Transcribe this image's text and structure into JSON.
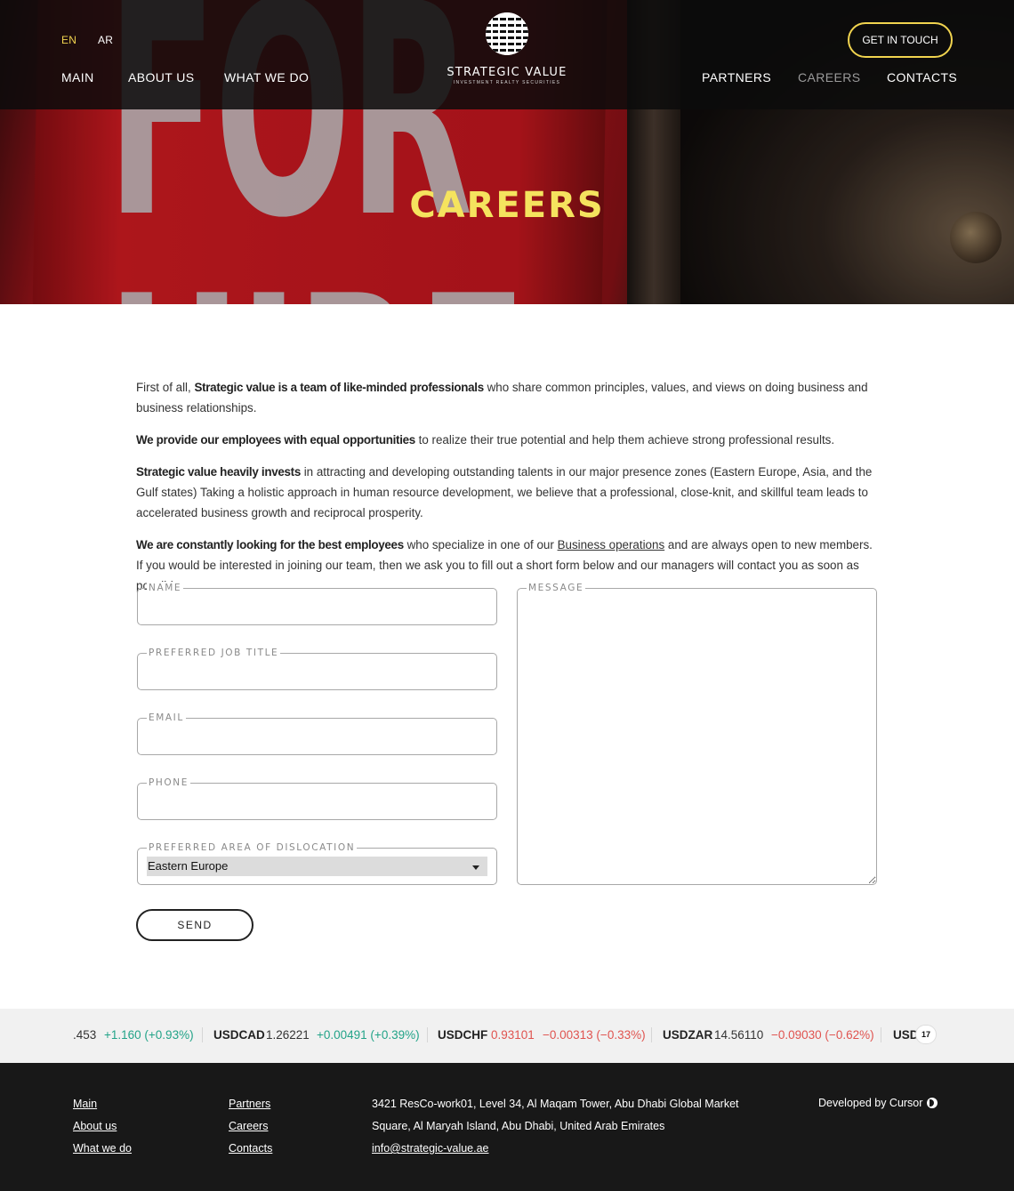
{
  "header": {
    "languages": [
      {
        "code": "EN",
        "active": true
      },
      {
        "code": "AR",
        "active": false
      }
    ],
    "nav_left": [
      "MAIN",
      "ABOUT US",
      "WHAT WE DO"
    ],
    "nav_right": [
      "PARTNERS",
      "CAREERS",
      "CONTACTS"
    ],
    "active_nav": "CAREERS",
    "logo_name": "STRATEGIC VALUE",
    "logo_tagline": "INVESTMENT REALTY SECURITIES",
    "cta_label": "GET IN TOUCH"
  },
  "hero": {
    "title": "CAREERS",
    "background_image": "for-hire-sign-photo"
  },
  "intro": [
    {
      "lead": "",
      "before": "First of all, ",
      "bold": "Strategic value is a team of like-minded professionals",
      "after": " who share common principles, values, and views on doing business and business relationships."
    },
    {
      "before": "",
      "bold": "We provide our employees with equal opportunities",
      "after": " to realize their true potential and help them achieve strong professional results."
    },
    {
      "before": "",
      "bold": "Strategic value heavily invests",
      "after": " in attracting and developing outstanding talents in our major presence zones (Eastern Europe, Asia, and the Gulf states) Taking a holistic approach in human resource development, we believe that a professional, close-knit, and skillful team leads to accelerated business growth and reciprocal prosperity."
    },
    {
      "before": "",
      "bold": "We are constantly looking for the best employees",
      "after_pre_link": " who specialize in one of our ",
      "link": "Business operations",
      "after": " and are always open to new members. If you would be interested in joining our team, then we ask you to fill out a short form below and our managers will contact you as soon as possible."
    }
  ],
  "form": {
    "name_label": "NAME",
    "job_label": "PREFERRED JOB TITLE",
    "email_label": "EMAIL",
    "phone_label": "PHONE",
    "area_label": "PREFERRED AREA OF DISLOCATION",
    "area_selected": "Eastern Europe",
    "message_label": "MESSAGE",
    "send_label": "SEND"
  },
  "ticker": {
    "items": [
      {
        "symbol": "",
        "price": ".453",
        "change": "+1.160 (+0.93%)",
        "direction": "up"
      },
      {
        "symbol": "USDCAD",
        "price": "1.26221",
        "change": "+0.00491 (+0.39%)",
        "direction": "up"
      },
      {
        "symbol": "USDCHF",
        "price": "0.93101",
        "change": "−0.00313 (−0.33%)",
        "direction": "down"
      },
      {
        "symbol": "USDZAR",
        "price": "14.56110",
        "change": "−0.09030 (−0.62%)",
        "direction": "down"
      },
      {
        "symbol": "USD",
        "price": "",
        "change": "",
        "direction": "none"
      }
    ],
    "badge": "17"
  },
  "footer": {
    "col1": [
      "Main",
      "About us",
      "What we do"
    ],
    "col2": [
      "Partners",
      "Careers",
      "Contacts"
    ],
    "address_line1": "3421 ResCo-work01, Level 34, Al Maqam Tower, Abu Dhabi Global Market",
    "address_line2": "Square, Al Maryah Island, Abu Dhabi, United Arab Emirates",
    "email": "info@strategic-value.ae",
    "developed_by": "Developed by Cursor"
  },
  "colors": {
    "accent_yellow": "#f1d44f",
    "hero_title": "#f5e35e",
    "ticker_up": "#22a388",
    "ticker_down": "#e0534f",
    "footer_bg": "#181818"
  }
}
